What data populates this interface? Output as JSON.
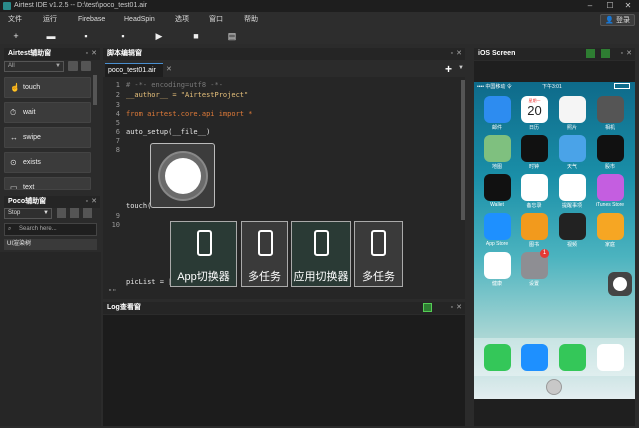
{
  "window": {
    "title": "Airtest IDE v1.2.5 -- D:\\test\\poco_test01.air"
  },
  "menu": {
    "items": [
      "文件",
      "运行",
      "Firebase",
      "HeadSpin",
      "选项",
      "窗口",
      "帮助"
    ],
    "login": "登录"
  },
  "left_panel": {
    "title": "Airtest辅助窗",
    "filter": "All",
    "buttons": [
      "touch",
      "wait",
      "swipe",
      "exists",
      "text"
    ]
  },
  "poco_panel": {
    "title": "Poco辅助窗",
    "mode": "Stop",
    "search_placeholder": "Search here...",
    "tree_root": "UI渲染树"
  },
  "editor_panel": {
    "title": "脚本编辑窗",
    "tab": "poco_test01.air",
    "lines": [
      {
        "n": "1",
        "t": "# -*- encoding=utf8 -*-"
      },
      {
        "n": "2",
        "t": "__author__ = \"AirtestProject\""
      },
      {
        "n": "3",
        "t": ""
      },
      {
        "n": "4",
        "t": "from airtest.core.api import *"
      },
      {
        "n": "5",
        "t": ""
      },
      {
        "n": "6",
        "t": "auto_setup(__file__)"
      },
      {
        "n": "7",
        "t": ""
      },
      {
        "n": "8",
        "t": ""
      },
      {
        "n": "9",
        "t": ""
      },
      {
        "n": "10",
        "t": ""
      }
    ],
    "touch_call": "touch(",
    "piclist": "picList = [",
    "marker": "\"\""
  },
  "switcher": {
    "labels": [
      "App切换器",
      "多任务",
      "应用切换器",
      "多任务"
    ]
  },
  "log_panel": {
    "title": "Log查看窗"
  },
  "ios_panel": {
    "title": "iOS Screen",
    "status": {
      "carrier": "•••• 中国移动 令",
      "time": "下午3:01"
    },
    "calendar": {
      "weekday": "星期一",
      "day": "20"
    },
    "apps": [
      {
        "label": "邮件",
        "color": "#2d8cf0"
      },
      {
        "label": "日历",
        "color": "#ffffff"
      },
      {
        "label": "照片",
        "color": "#f5f5f5"
      },
      {
        "label": "相机",
        "color": "#555555"
      },
      {
        "label": "地图",
        "color": "#7fc07f"
      },
      {
        "label": "时钟",
        "color": "#111111"
      },
      {
        "label": "天气",
        "color": "#4aa3e8"
      },
      {
        "label": "股市",
        "color": "#111111"
      },
      {
        "label": "Wallet",
        "color": "#111111"
      },
      {
        "label": "备忘录",
        "color": "#ffffff"
      },
      {
        "label": "提醒事项",
        "color": "#ffffff"
      },
      {
        "label": "iTunes Store",
        "color": "#c45ee0"
      },
      {
        "label": "App Store",
        "color": "#1e90ff"
      },
      {
        "label": "图书",
        "color": "#f29a1d"
      },
      {
        "label": "视频",
        "color": "#222222"
      },
      {
        "label": "家庭",
        "color": "#f6a623"
      },
      {
        "label": "健康",
        "color": "#ffffff"
      },
      {
        "label": "设置",
        "color": "#8e8e93"
      }
    ],
    "settings_badge": "1",
    "dock": [
      "电话",
      "Safari",
      "信息",
      "音乐"
    ]
  }
}
